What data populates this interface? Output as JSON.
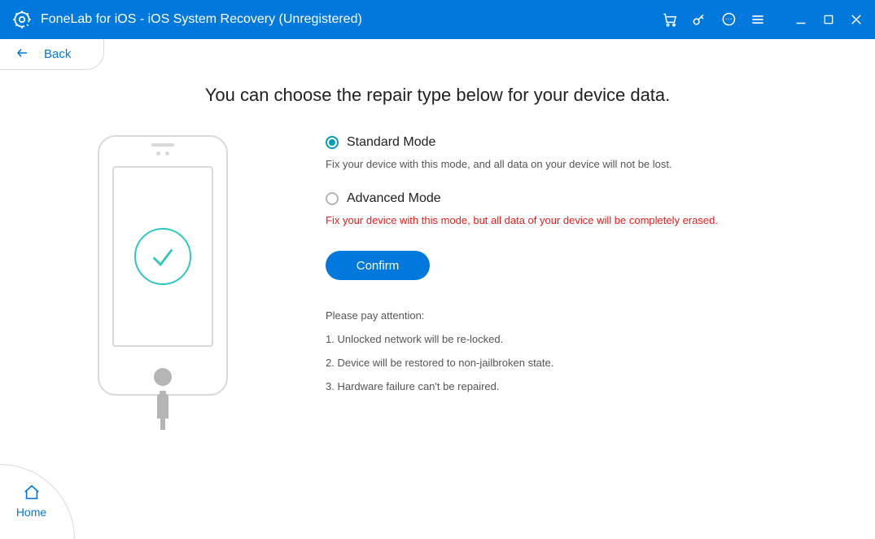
{
  "titlebar": {
    "title": "FoneLab for iOS - iOS System Recovery (Unregistered)"
  },
  "back": {
    "label": "Back"
  },
  "home": {
    "label": "Home"
  },
  "page": {
    "heading": "You can choose the repair type below for your device data."
  },
  "options": {
    "standard": {
      "label": "Standard Mode",
      "desc": "Fix your device with this mode, and all data on your device will not be lost.",
      "selected": true
    },
    "advanced": {
      "label": "Advanced Mode",
      "desc": "Fix your device with this mode, but all data of your device will be completely erased.",
      "selected": false
    }
  },
  "confirm": {
    "label": "Confirm"
  },
  "attention": {
    "title": "Please pay attention:",
    "items": [
      "1. Unlocked network will be re-locked.",
      "2. Device will be restored to non-jailbroken state.",
      "3. Hardware failure can't be repaired."
    ]
  },
  "colors": {
    "primary": "#0078dc",
    "accent": "#2fc7c1",
    "danger": "#e02020"
  }
}
